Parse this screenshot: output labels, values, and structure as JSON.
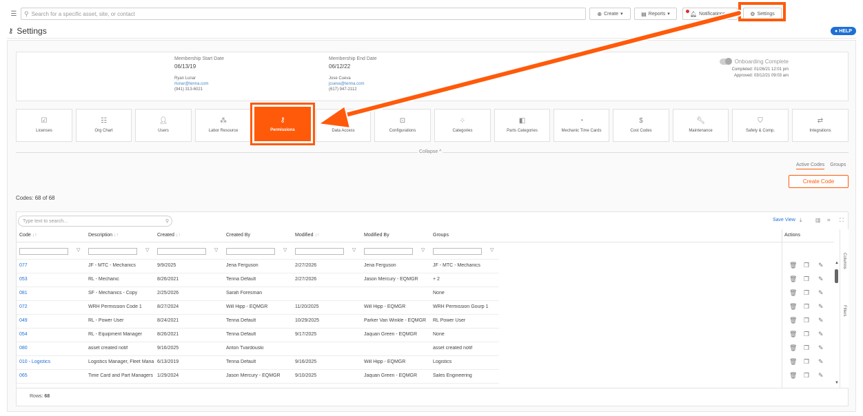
{
  "topbar": {
    "search_placeholder": "Search for a specific asset, site, or contact",
    "create_label": "Create",
    "reports_label": "Reports",
    "notifications_label": "Notifications",
    "settings_label": "Settings"
  },
  "header": {
    "title": "Settings",
    "help_label": "HELP"
  },
  "membership": {
    "start_label": "Membership Start Date",
    "start_date": "06/13/19",
    "start_contact_name": "Ryan Lunar",
    "start_contact_email": "rlunar@tenna.com",
    "start_contact_phone": "(941) 313-6021",
    "end_label": "Membership End Date",
    "end_date": "06/12/22",
    "end_contact_name": "Jose Cueva",
    "end_contact_email": "jcueva@tenna.com",
    "end_contact_phone": "(617) 947-2112",
    "onboarding_label": "Onboarding Complete",
    "completed_text": "Completed: 01/26/21 12:01 pm",
    "approved_text": "Approved: 03/12/21 09:03 am"
  },
  "tiles": [
    {
      "label": "Licenses"
    },
    {
      "label": "Org Chart"
    },
    {
      "label": "Users"
    },
    {
      "label": "Labor Resource"
    },
    {
      "label": "Permissions"
    },
    {
      "label": "Data Access"
    },
    {
      "label": "Configurations"
    },
    {
      "label": "Categories"
    },
    {
      "label": "Parts Categories"
    },
    {
      "label": "Mechanic Time Cards"
    },
    {
      "label": "Cost Codes"
    },
    {
      "label": "Maintenance"
    },
    {
      "label": "Safety & Comp."
    },
    {
      "label": "Integrations"
    }
  ],
  "collapse_label": "Collapse ^",
  "tabs": {
    "active": "Active Codes",
    "groups": "Groups"
  },
  "create_code_label": "Create Code",
  "codes_count": "Codes: 68 of 68",
  "table": {
    "search_placeholder": "Type text to search...",
    "save_view": "Save View",
    "columns": [
      "Code",
      "Description",
      "Created",
      "Created By",
      "Modified",
      "Modified By",
      "Groups"
    ],
    "actions_header": "Actions",
    "rows": [
      [
        "077",
        "JF - MTC - Mechanics",
        "9/9/2025",
        "Jena Ferguson",
        "2/27/2026",
        "Jena Ferguson",
        "JF - MTC - Mechanics"
      ],
      [
        "053",
        "RL - Mechanic",
        "8/26/2021",
        "Tenna Default",
        "2/27/2026",
        "Jason Mercury - EQMGR",
        "+ 2"
      ],
      [
        "081",
        "SF - Mechanics - Copy",
        "2/25/2026",
        "Sarah Foresman",
        "",
        "",
        "None"
      ],
      [
        "072",
        "WRH Permission Code 1",
        "8/27/2024",
        "Will Hipp - EQMGR",
        "11/20/2025",
        "Will Hipp - EQMGR",
        "WRH Permission Gourp 1"
      ],
      [
        "049",
        "RL - Power User",
        "8/24/2021",
        "Tenna Default",
        "10/29/2025",
        "Parker Van Winkle - EQMGR",
        "RL Power User"
      ],
      [
        "054",
        "RL - Equipment Manager",
        "8/26/2021",
        "Tenna Default",
        "9/17/2025",
        "Jaquan Green - EQMGR",
        "None"
      ],
      [
        "080",
        "asset created notif",
        "9/16/2025",
        "Anton Tvardouski",
        "",
        "",
        "asset created notif"
      ],
      [
        "010 - Logistics",
        "Logistics Manager, Fleet Mana",
        "6/13/2019",
        "Tenna Default",
        "9/16/2025",
        "Will Hipp - EQMGR",
        "Logistics"
      ],
      [
        "065",
        "Time Card and Part Managers",
        "1/29/2024",
        "Jason Mercury - EQMGR",
        "9/10/2025",
        "Jaquan Green - EQMGR",
        "Sales Engineering"
      ]
    ],
    "columns_label": "Columns",
    "filters_label": "Filters",
    "rows_label": "Rows:",
    "rows_count": "68"
  },
  "colors": {
    "accent": "#ff5a0a",
    "link": "#1f6fd4",
    "help": "#1f6fd4"
  }
}
